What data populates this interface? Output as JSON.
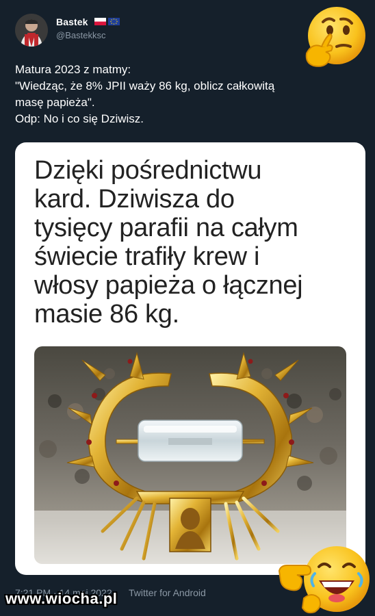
{
  "tweet": {
    "author_name": "Bastek",
    "handle": "@Bastekksc",
    "text_lines": [
      "Matura 2023 z matmy:",
      "\"Wiedząc, że 8% JPII waży 86 kg, oblicz całkowitą",
      "masę papieża\".",
      "Odp: No i co się Dziwisz."
    ],
    "timestamp": "7:21 PM · 14 maj 2022",
    "client": "Twitter for Android"
  },
  "card": {
    "text_lines": [
      "Dzięki pośrednictwu",
      "kard. Dziwisza do",
      "tysięcy parafii na całym",
      "świecie trafiły krew i",
      "włosy papieża o łącznej",
      "masie 86 kg."
    ]
  },
  "watermark": {
    "text": "www.wiocha.pl"
  },
  "icons": {
    "thinking": "thinking-face-icon",
    "laughing": "laughing-pointing-face-icon",
    "poland_flag": "poland-flag-icon",
    "eu_flag": "eu-flag-icon"
  },
  "colors": {
    "background": "#15202b",
    "secondary_text": "#8b98a5",
    "card_background": "#ffffff",
    "card_text": "#222222",
    "emoji_yellow": "#f9c21d"
  }
}
